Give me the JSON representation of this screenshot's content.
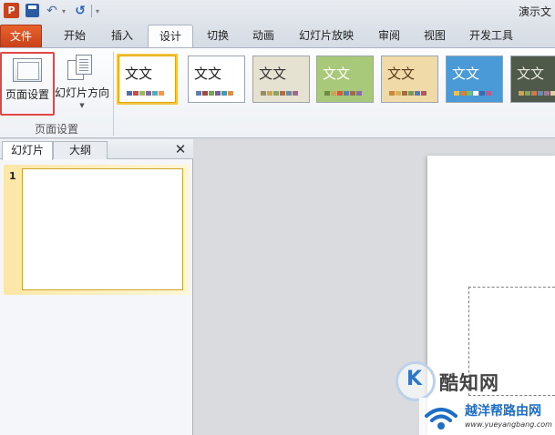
{
  "window": {
    "title": "演示文"
  },
  "quick_access": {
    "app_glyph": "P",
    "undo_glyph": "↶",
    "redo_glyph": "↺",
    "dropdown_glyph": "▾"
  },
  "ribbon_tabs": [
    {
      "label": "文件"
    },
    {
      "label": "开始"
    },
    {
      "label": "插入"
    },
    {
      "label": "设计"
    },
    {
      "label": "切换"
    },
    {
      "label": "动画"
    },
    {
      "label": "幻灯片放映"
    },
    {
      "label": "审阅"
    },
    {
      "label": "视图"
    },
    {
      "label": "开发工具"
    }
  ],
  "active_tab": "设计",
  "page_setup_group": {
    "page_setup_label": "页面设置",
    "orientation_label": "幻灯片方向",
    "dropdown_glyph": "▼",
    "group_label": "页面设置"
  },
  "themes": [
    {
      "text": "文文",
      "bg": "#ffffff",
      "text_color": "#222222",
      "selected": true,
      "dots": [
        "#4f6fa8",
        "#c0504d",
        "#9bbb59",
        "#8064a2",
        "#4bacc6",
        "#f79646"
      ]
    },
    {
      "text": "文文",
      "bg": "#ffffff",
      "text_color": "#222222",
      "selected": false,
      "dots": [
        "#5a7fb8",
        "#a04a48",
        "#7aa550",
        "#76609a",
        "#3d9db8",
        "#e98a3a"
      ]
    },
    {
      "text": "文文",
      "bg": "#e6e2d2",
      "text_color": "#333333",
      "selected": false,
      "dots": [
        "#9a8c6a",
        "#c9a55a",
        "#8aa36b",
        "#b0703e",
        "#6b8aa8",
        "#a06a8a"
      ]
    },
    {
      "text": "文文",
      "bg": "#a9c97a",
      "text_color": "#ffffff",
      "selected": false,
      "dots": [
        "#6e8c3e",
        "#c6a45a",
        "#d05a3a",
        "#5a7fa8",
        "#a06a4a",
        "#8a6aa8"
      ]
    },
    {
      "text": "文文",
      "bg": "#f0dba8",
      "text_color": "#5a3a1a",
      "selected": false,
      "dots": [
        "#c9863a",
        "#d6b25a",
        "#a86a3a",
        "#7a9a5a",
        "#5a7aa8",
        "#b05a5a"
      ]
    },
    {
      "text": "文文",
      "bg": "#4a9ad8",
      "text_color": "#ffffff",
      "selected": false,
      "dots": [
        "#f0c040",
        "#e07a3a",
        "#7ac06a",
        "#ffffff",
        "#3a6ab0",
        "#c05a8a"
      ]
    },
    {
      "text": "文文",
      "bg": "#4f5a4a",
      "text_color": "#e8e8e0",
      "selected": false,
      "dots": [
        "#c9a55a",
        "#8aa36b",
        "#d07a4a",
        "#6a8ab0",
        "#a07a9a",
        "#e0d0a0"
      ]
    }
  ],
  "left_panel": {
    "tabs": [
      {
        "label": "幻灯片"
      },
      {
        "label": "大纲"
      }
    ],
    "close_glyph": "✕",
    "slides": [
      {
        "number": "1"
      }
    ]
  },
  "watermarks": {
    "kuzhi_glyph": "K",
    "kuzhi_text": "酷知网",
    "router_title": "越洋帮路由网",
    "router_url": "www.yueyangbang.com"
  }
}
